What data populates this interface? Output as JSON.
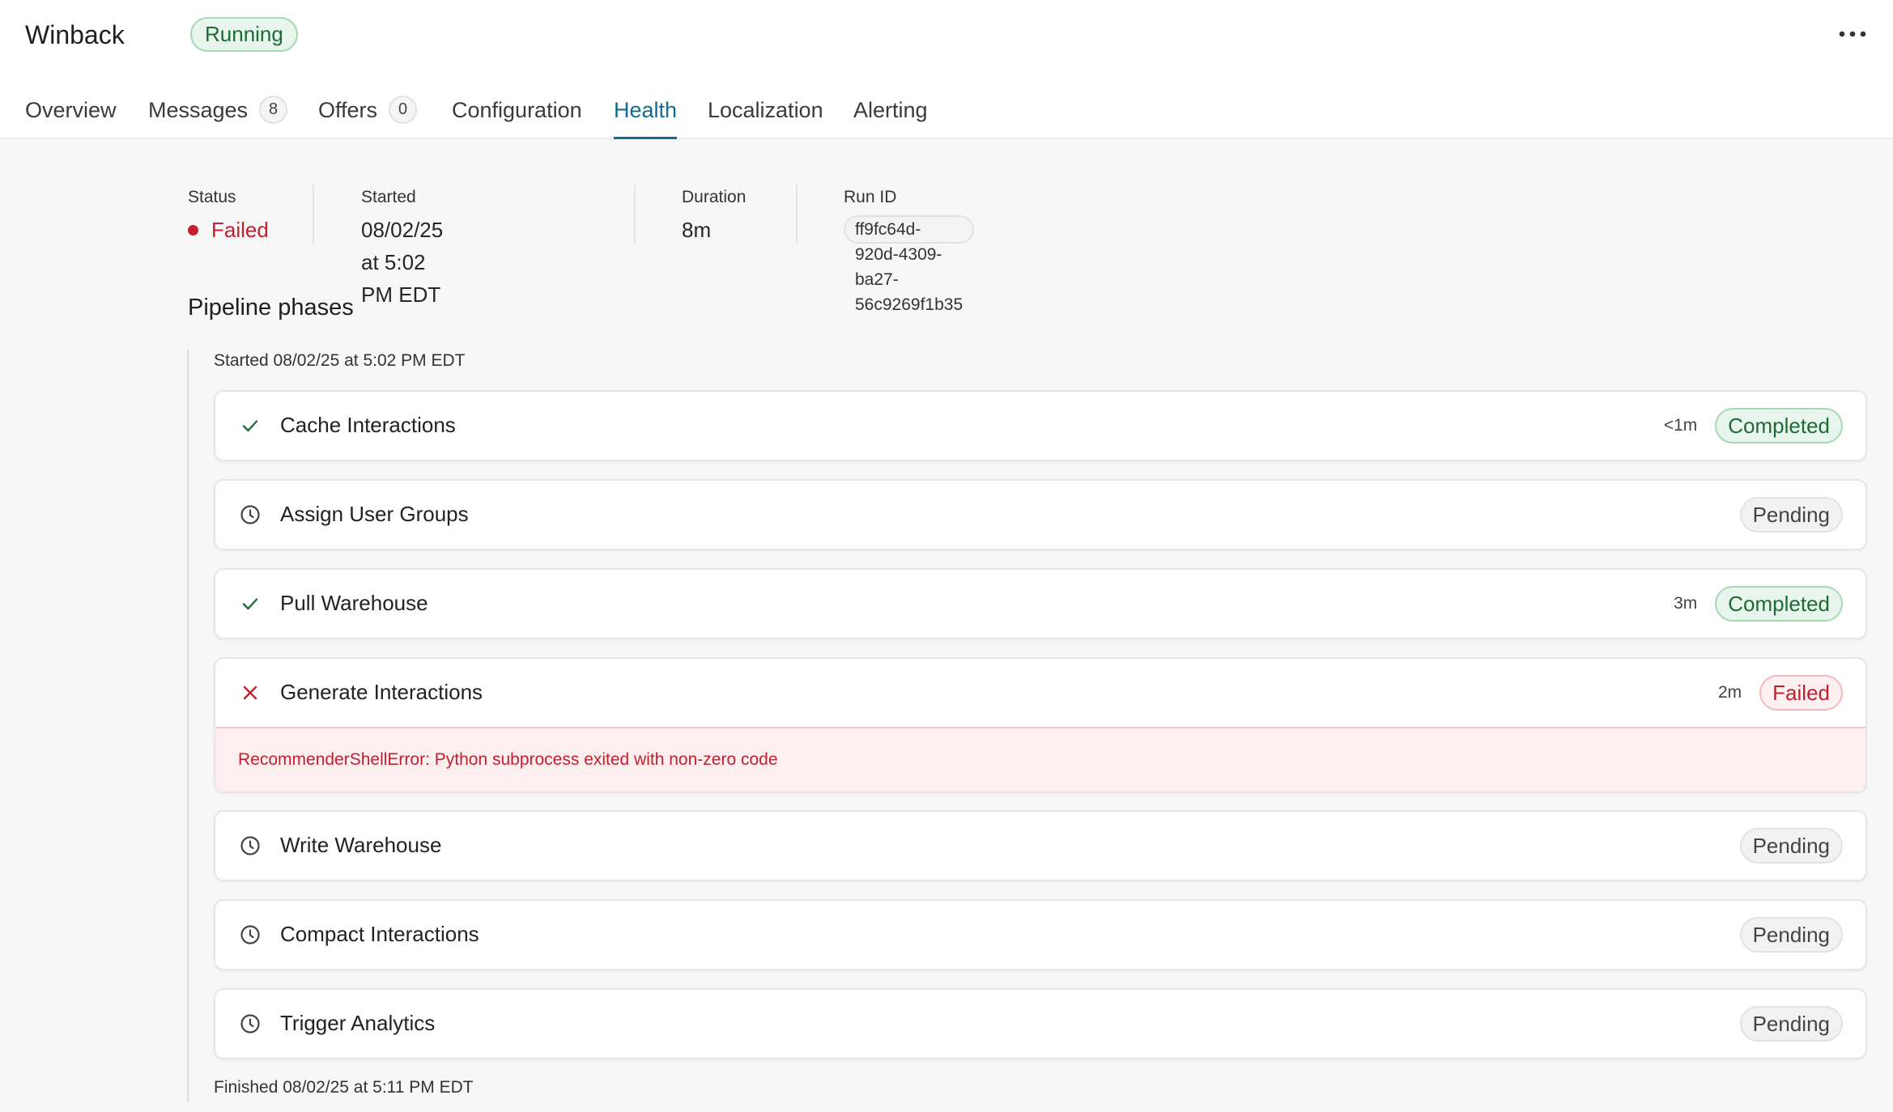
{
  "header": {
    "title": "Winback",
    "status_badge": "Running",
    "more_icon": "more-horizontal-icon"
  },
  "tabs": [
    {
      "label": "Overview"
    },
    {
      "label": "Messages",
      "count": "8"
    },
    {
      "label": "Offers",
      "count": "0"
    },
    {
      "label": "Configuration"
    },
    {
      "label": "Health",
      "active": true
    },
    {
      "label": "Localization"
    },
    {
      "label": "Alerting"
    }
  ],
  "summary": {
    "status_label": "Status",
    "status_value": "Failed",
    "started_label": "Started",
    "started_value": "08/02/25 at 5:02 PM EDT",
    "duration_label": "Duration",
    "duration_value": "8m",
    "run_id_label": "Run ID",
    "run_id_value": "ff9fc64d-920d-4309-ba27-56c9269f1b35"
  },
  "pipeline": {
    "title": "Pipeline phases",
    "started_note": "Started 08/02/25 at 5:02 PM EDT",
    "finished_note": "Finished 08/02/25 at 5:11 PM EDT",
    "phases": [
      {
        "name": "Cache Interactions",
        "icon": "check-icon",
        "duration": "<1m",
        "status": "Completed"
      },
      {
        "name": "Assign User Groups",
        "icon": "clock-icon",
        "duration": "",
        "status": "Pending"
      },
      {
        "name": "Pull Warehouse",
        "icon": "check-icon",
        "duration": "3m",
        "status": "Completed"
      },
      {
        "name": "Generate Interactions",
        "icon": "x-icon",
        "duration": "2m",
        "status": "Failed",
        "error": "RecommenderShellError: Python subprocess exited with non-zero code"
      },
      {
        "name": "Write Warehouse",
        "icon": "clock-icon",
        "duration": "",
        "status": "Pending"
      },
      {
        "name": "Compact Interactions",
        "icon": "clock-icon",
        "duration": "",
        "status": "Pending"
      },
      {
        "name": "Trigger Analytics",
        "icon": "clock-icon",
        "duration": "",
        "status": "Pending"
      }
    ]
  },
  "colors": {
    "accent": "#0f6e8e",
    "success": "#1d6b34",
    "danger": "#c2202f"
  }
}
